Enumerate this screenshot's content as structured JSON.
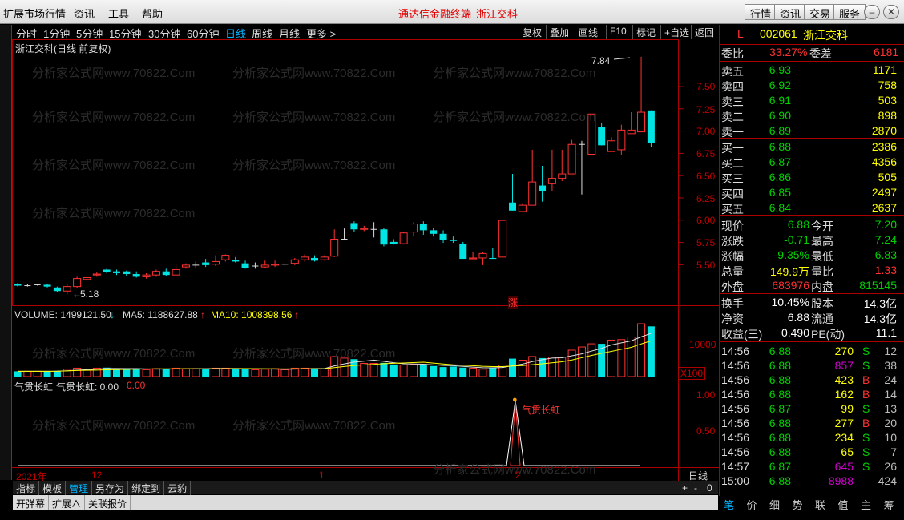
{
  "menu": {
    "items": [
      "扩展市场行情",
      "资讯",
      "工具",
      "帮助"
    ],
    "center": [
      "通达信金融终端",
      "浙江交科"
    ],
    "right_buttons": [
      "行情",
      "资讯",
      "交易",
      "服务"
    ]
  },
  "toolbar": {
    "periods": [
      "分时",
      "1分钟",
      "5分钟",
      "15分钟",
      "30分钟",
      "60分钟",
      "日线",
      "周线",
      "月线",
      "更多 >"
    ],
    "active_period": "日线",
    "buttons": [
      "复权",
      "叠加",
      "画线",
      "F10",
      "标记",
      "+自选",
      "返回"
    ]
  },
  "chart": {
    "title": "浙江交科(日线 前复权)",
    "high_label": "7.84",
    "low_label": "5.18",
    "y_ticks": [
      "7.50",
      "7.25",
      "7.00",
      "6.75",
      "6.50",
      "6.25",
      "6.00",
      "5.75",
      "5.50"
    ],
    "limit_marker": "涨",
    "watermark": "分析家公式网www.70822.Com"
  },
  "volume": {
    "label": "VOLUME: 1499121.50",
    "ma5": "MA5: 1188627.88",
    "ma10": "MA10: 1008398.56",
    "scale": "10000",
    "unit": "X100"
  },
  "indicator": {
    "name": "气贯长虹",
    "value_label": "气贯长虹: 0.00",
    "value": "0.00",
    "ticks": [
      "1.00",
      "0.50"
    ],
    "signal_label": "气贯长虹"
  },
  "timeline": {
    "labels": [
      "2021年",
      "12",
      "1",
      "2"
    ],
    "period": "日线",
    "zoom": [
      "+",
      "-",
      "0"
    ]
  },
  "bottom_tabs": [
    "指标",
    "模板",
    "管理",
    "另存为",
    "绑定到",
    "云豹"
  ],
  "status_tabs": [
    "开弹幕",
    "扩展∧",
    "关联报价"
  ],
  "quote": {
    "code": "002061",
    "name": "浙江交科",
    "l_mark": "L",
    "weibi_label": "委比",
    "weibi": "33.27%",
    "weicha_label": "委差",
    "weicha": "6181",
    "sell": [
      {
        "label": "卖五",
        "price": "6.93",
        "vol": "1171"
      },
      {
        "label": "卖四",
        "price": "6.92",
        "vol": "758"
      },
      {
        "label": "卖三",
        "price": "6.91",
        "vol": "503"
      },
      {
        "label": "卖二",
        "price": "6.90",
        "vol": "898"
      },
      {
        "label": "卖一",
        "price": "6.89",
        "vol": "2870"
      }
    ],
    "buy": [
      {
        "label": "买一",
        "price": "6.88",
        "vol": "2386"
      },
      {
        "label": "买二",
        "price": "6.87",
        "vol": "4356"
      },
      {
        "label": "买三",
        "price": "6.86",
        "vol": "505"
      },
      {
        "label": "买四",
        "price": "6.85",
        "vol": "2497"
      },
      {
        "label": "买五",
        "price": "6.84",
        "vol": "2637"
      }
    ],
    "stats": [
      {
        "l1": "现价",
        "v1": "6.88",
        "l2": "今开",
        "v2": "7.20"
      },
      {
        "l1": "涨跌",
        "v1": "-0.71",
        "l2": "最高",
        "v2": "7.24"
      },
      {
        "l1": "涨幅",
        "v1": "-9.35%",
        "l2": "最低",
        "v2": "6.83"
      },
      {
        "l1": "总量",
        "v1": "149.9万",
        "l2": "量比",
        "v2": "1.33"
      },
      {
        "l1": "外盘",
        "v1": "683976",
        "l2": "内盘",
        "v2": "815145"
      }
    ],
    "fin": [
      {
        "l1": "换手",
        "v1": "10.45%",
        "l2": "股本",
        "v2": "14.3亿"
      },
      {
        "l1": "净资",
        "v1": "6.88",
        "l2": "流通",
        "v2": "14.3亿"
      },
      {
        "l1": "收益(三)",
        "v1": "0.490",
        "l2": "PE(动)",
        "v2": "11.1"
      }
    ],
    "ticks": [
      {
        "time": "14:56",
        "price": "6.88",
        "vol": "270",
        "bs": "S",
        "n": "12"
      },
      {
        "time": "14:56",
        "price": "6.88",
        "vol": "857",
        "bs": "S",
        "n": "38"
      },
      {
        "time": "14:56",
        "price": "6.88",
        "vol": "423",
        "bs": "B",
        "n": "24"
      },
      {
        "time": "14:56",
        "price": "6.88",
        "vol": "162",
        "bs": "B",
        "n": "14"
      },
      {
        "time": "14:56",
        "price": "6.87",
        "vol": "99",
        "bs": "S",
        "n": "13"
      },
      {
        "time": "14:56",
        "price": "6.88",
        "vol": "277",
        "bs": "B",
        "n": "20"
      },
      {
        "time": "14:56",
        "price": "6.88",
        "vol": "234",
        "bs": "S",
        "n": "10"
      },
      {
        "time": "14:56",
        "price": "6.88",
        "vol": "65",
        "bs": "S",
        "n": "7"
      },
      {
        "time": "14:57",
        "price": "6.87",
        "vol": "645",
        "bs": "S",
        "n": "26"
      },
      {
        "time": "15:00",
        "price": "6.88",
        "vol": "8988",
        "bs": "",
        "n": "424"
      }
    ],
    "tabs": [
      "笔",
      "价",
      "细",
      "势",
      "联",
      "值",
      "主",
      "筹"
    ]
  },
  "colors": {
    "up": "#ff3232",
    "down": "#00e4e4",
    "green": "#00d000",
    "yellow": "#ffff00",
    "ma": "#e0e0e0"
  }
}
